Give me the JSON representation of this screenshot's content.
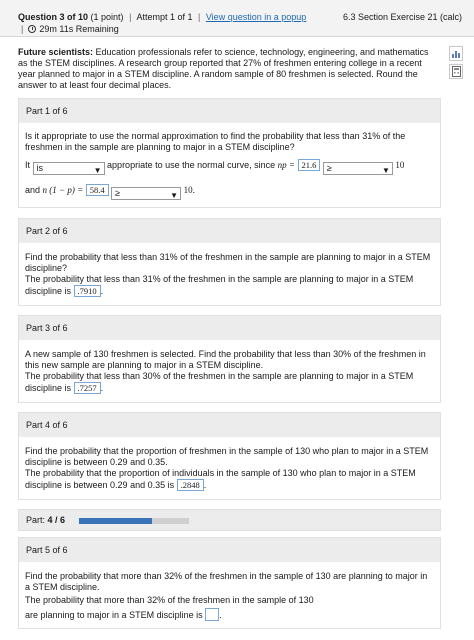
{
  "header": {
    "question_prefix": "Question 3 of 10",
    "points": "(1 point)",
    "attempt": "Attempt 1 of 1",
    "popup_link": "View question in a popup",
    "time_remaining": "29m 11s Remaining",
    "section": "6.3 Section Exercise 21 (calc)"
  },
  "intro": {
    "bold_lead": "Future scientists:",
    "text": " Education professionals refer to science, technology, engineering, and mathematics as the STEM disciplines. A research group reported that 27% of freshmen entering college in a recent year planned to major in a STEM discipline. A random sample of 80 freshmen is selected. Round the answer to at least four decimal places."
  },
  "part1": {
    "title": "Part 1 of 6",
    "question": "Is it appropriate to use the normal approximation to find the probability that less than 31% of the freshmen in the sample are planning to major in a STEM discipline?",
    "it_label": "It",
    "select1": "is",
    "mid_text": "appropriate to use the normal curve, since",
    "np_label": "np =",
    "np_value": "21.6",
    "select2": "≥",
    "ten1": "10",
    "and_label": "and",
    "nq_label": "n (1 − p) =",
    "nq_value": "58.4",
    "select3": "≥",
    "ten2": "10."
  },
  "part2": {
    "title": "Part 2 of 6",
    "question": "Find the probability that less than 31% of the freshmen in the sample are planning to major in a STEM discipline?",
    "answer_text": "The probability that less than 31% of the freshmen in the sample are planning to major in a STEM discipline is",
    "answer": ".7910"
  },
  "part3": {
    "title": "Part 3 of 6",
    "question": "A new sample of 130 freshmen is selected. Find the probability that less than 30% of the freshmen in this new sample are planning to major in a STEM discipline.",
    "answer_text": "The probability that less than 30% of the freshmen in the sample are planning to major in a STEM discipline is",
    "answer": ".7257"
  },
  "part4": {
    "title": "Part 4 of 6",
    "question": "Find the probability that the proportion of freshmen in the sample of 130 who plan to major in a STEM discipline is between 0.29 and 0.35.",
    "answer_text": "The probability that the proportion of individuals in the sample of 130 who plan to major in a STEM discipline is between 0.29 and 0.35 is",
    "answer": ".2848"
  },
  "progress": {
    "label": "Part:",
    "value": "4 / 6",
    "fraction": 0.667
  },
  "part5": {
    "title": "Part 5 of 6",
    "question": "Find the probability that more than 32% of the freshmen in the sample of 130 are planning to major in a STEM discipline.",
    "answer_text_1": "The probability that more than 32% of the freshmen in the sample of 130",
    "answer_text_2": "are planning to major in a STEM discipline is"
  },
  "icons": {
    "stats_icon": "bar-chart-icon",
    "calc_icon": "calculator-icon"
  },
  "colors": {
    "link": "#1f6ab2",
    "progress_fill": "#3b73b9",
    "answer_border": "#7aa7d6"
  }
}
